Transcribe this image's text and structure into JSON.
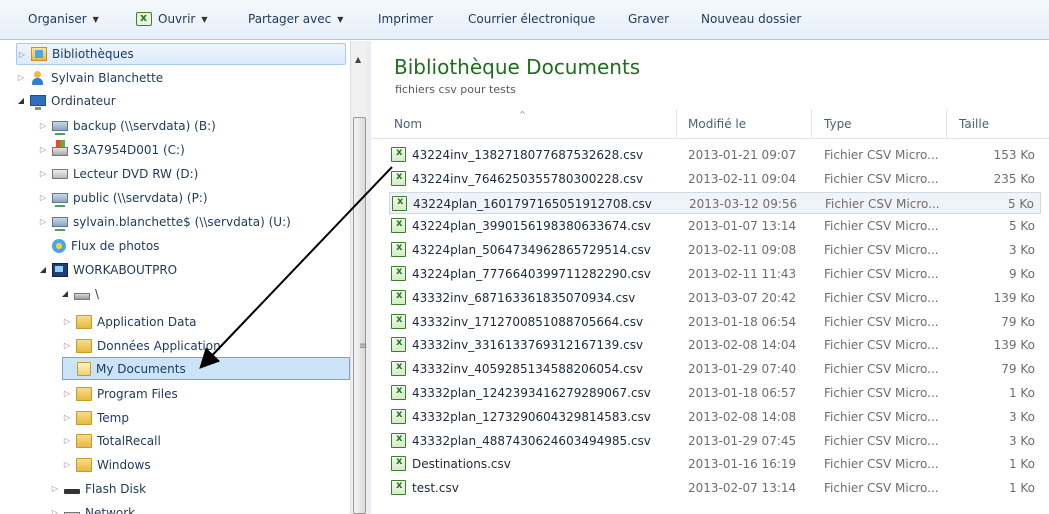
{
  "toolbar": {
    "organize": "Organiser",
    "open": "Ouvrir",
    "share": "Partager avec",
    "print": "Imprimer",
    "email": "Courrier électronique",
    "burn": "Graver",
    "new_folder": "Nouveau dossier"
  },
  "nav": {
    "items": [
      {
        "label": "Bibliothèques",
        "icon": "library-icon"
      },
      {
        "label": "Sylvain Blanchette",
        "icon": "user-icon"
      },
      {
        "label": "Ordinateur",
        "icon": "computer-icon"
      },
      {
        "label": "backup (\\\\servdata) (B:)",
        "icon": "network-drive-icon"
      },
      {
        "label": "S3A7954D001 (C:)",
        "icon": "windows-drive-icon"
      },
      {
        "label": "Lecteur DVD RW (D:)",
        "icon": "dvd-drive-icon"
      },
      {
        "label": "public (\\\\servdata) (P:)",
        "icon": "network-drive-icon"
      },
      {
        "label": "sylvain.blanchette$ (\\\\servdata) (U:)",
        "icon": "network-drive-icon"
      },
      {
        "label": "Flux de photos",
        "icon": "photo-stream-icon"
      },
      {
        "label": "WORKABOUTPRO",
        "icon": "device-icon"
      },
      {
        "label": "\\",
        "icon": "disk-icon"
      },
      {
        "label": "Application Data",
        "icon": "folder-icon"
      },
      {
        "label": "Données Application",
        "icon": "folder-icon"
      },
      {
        "label": "My Documents",
        "icon": "folder-open-icon"
      },
      {
        "label": "Program Files",
        "icon": "folder-icon"
      },
      {
        "label": "Temp",
        "icon": "folder-icon"
      },
      {
        "label": "TotalRecall",
        "icon": "folder-icon"
      },
      {
        "label": "Windows",
        "icon": "folder-icon"
      },
      {
        "label": "Flash Disk",
        "icon": "flash-disk-icon"
      },
      {
        "label": "Network",
        "icon": "network-icon"
      }
    ]
  },
  "content": {
    "title": "Bibliothèque Documents",
    "subtitle": "fichiers csv pour tests",
    "columns": {
      "name": "Nom",
      "modified": "Modifié le",
      "type": "Type",
      "size": "Taille"
    },
    "files": [
      {
        "name": "43224inv_1382718077687532628.csv",
        "modified": "2013-01-21 09:07",
        "type": "Fichier CSV Micro...",
        "size": "153 Ko"
      },
      {
        "name": "43224inv_7646250355780300228.csv",
        "modified": "2013-02-11 09:04",
        "type": "Fichier CSV Micro...",
        "size": "235 Ko"
      },
      {
        "name": "43224plan_1601797165051912708.csv",
        "modified": "2013-03-12 09:56",
        "type": "Fichier CSV Micro...",
        "size": "5 Ko"
      },
      {
        "name": "43224plan_3990156198380633674.csv",
        "modified": "2013-01-07 13:14",
        "type": "Fichier CSV Micro...",
        "size": "5 Ko"
      },
      {
        "name": "43224plan_5064734962865729514.csv",
        "modified": "2013-02-11 09:08",
        "type": "Fichier CSV Micro...",
        "size": "3 Ko"
      },
      {
        "name": "43224plan_7776640399711282290.csv",
        "modified": "2013-02-11 11:43",
        "type": "Fichier CSV Micro...",
        "size": "9 Ko"
      },
      {
        "name": "43332inv_687163361835070934.csv",
        "modified": "2013-03-07 20:42",
        "type": "Fichier CSV Micro...",
        "size": "139 Ko"
      },
      {
        "name": "43332inv_1712700851088705664.csv",
        "modified": "2013-01-18 06:54",
        "type": "Fichier CSV Micro...",
        "size": "79 Ko"
      },
      {
        "name": "43332inv_3316133769312167139.csv",
        "modified": "2013-02-08 14:04",
        "type": "Fichier CSV Micro...",
        "size": "139 Ko"
      },
      {
        "name": "43332inv_4059285134588206054.csv",
        "modified": "2013-01-29 07:40",
        "type": "Fichier CSV Micro...",
        "size": "79 Ko"
      },
      {
        "name": "43332plan_1242393416279289067.csv",
        "modified": "2013-01-18 06:57",
        "type": "Fichier CSV Micro...",
        "size": "1 Ko"
      },
      {
        "name": "43332plan_1273290604329814583.csv",
        "modified": "2013-02-08 14:08",
        "type": "Fichier CSV Micro...",
        "size": "3 Ko"
      },
      {
        "name": "43332plan_4887430624603494985.csv",
        "modified": "2013-01-29 07:45",
        "type": "Fichier CSV Micro...",
        "size": "3 Ko"
      },
      {
        "name": "Destinations.csv",
        "modified": "2013-01-16 16:19",
        "type": "Fichier CSV Micro...",
        "size": "1 Ko"
      },
      {
        "name": "test.csv",
        "modified": "2013-02-07 13:14",
        "type": "Fichier CSV Micro...",
        "size": "1 Ko"
      }
    ]
  },
  "colors": {
    "title_green": "#1e6e1e",
    "toolbar_text": "#1e395b",
    "arrow": "#000000"
  }
}
